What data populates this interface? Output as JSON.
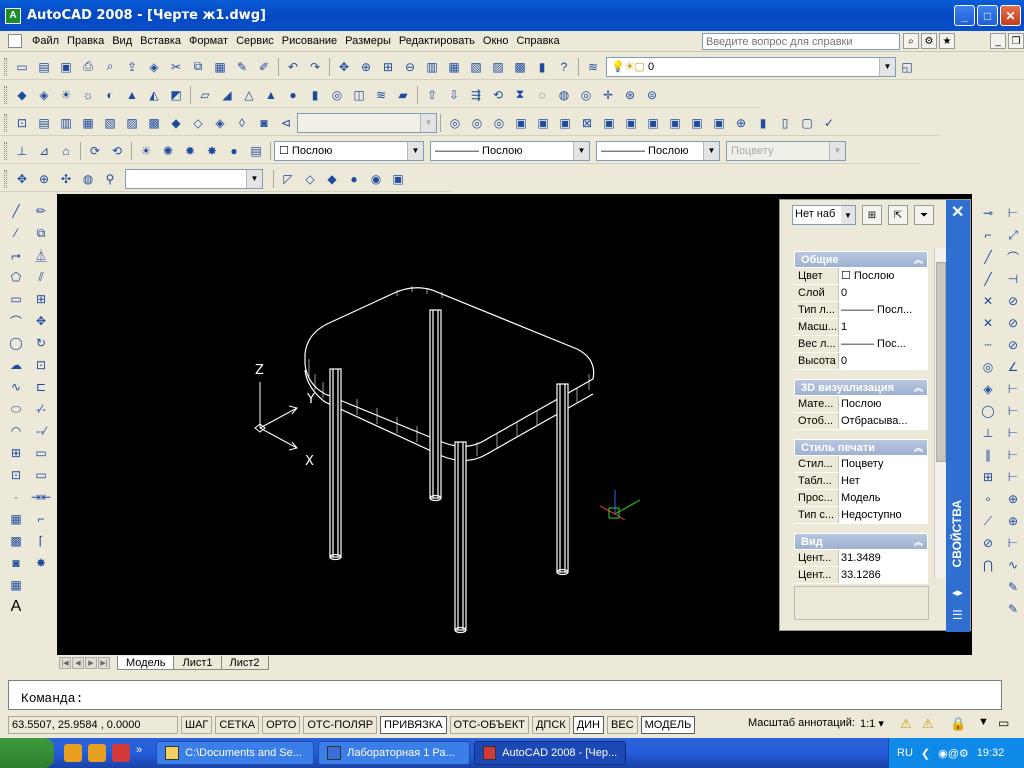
{
  "window": {
    "title": "AutoCAD 2008 - [Черте ж1.dwg]",
    "minimize": "_",
    "maximize": "□",
    "close": "✕"
  },
  "menu": {
    "items": [
      "Файл",
      "Правка",
      "Вид",
      "Вставка",
      "Формат",
      "Сервис",
      "Рисование",
      "Размеры",
      "Редактировать",
      "Окно",
      "Справка"
    ]
  },
  "help": {
    "placeholder": "Введите вопрос для справки"
  },
  "layers_toolbar": {
    "layer_value": "0"
  },
  "properties_toolbar": {
    "color": "☐ Послою",
    "linetype": "———— Послою",
    "lineweight": "———— Послою",
    "plotstyle": "Поцвету"
  },
  "ucs": {
    "z": "Z",
    "y": "Y",
    "x": "X"
  },
  "props_panel": {
    "selection": "Нет наб",
    "vertical_title": "СВОЙСТВА",
    "sections": [
      {
        "title": "Общие",
        "rows": [
          {
            "k": "Цвет",
            "v": "☐ Послою"
          },
          {
            "k": "Слой",
            "v": "0"
          },
          {
            "k": "Тип л...",
            "v": "——— Посл..."
          },
          {
            "k": "Масш...",
            "v": "1"
          },
          {
            "k": "Вес л...",
            "v": "——— Пос..."
          },
          {
            "k": "Высота",
            "v": "0"
          }
        ]
      },
      {
        "title": "3D визуализация",
        "rows": [
          {
            "k": "Мате...",
            "v": "Послою"
          },
          {
            "k": "Отоб...",
            "v": "Отбрасыва..."
          }
        ]
      },
      {
        "title": "Стиль печати",
        "rows": [
          {
            "k": "Стил...",
            "v": "Поцвету"
          },
          {
            "k": "Табл...",
            "v": "Нет"
          },
          {
            "k": "Прос...",
            "v": "Модель"
          },
          {
            "k": "Тип с...",
            "v": "Недоступно"
          }
        ]
      },
      {
        "title": "Вид",
        "rows": [
          {
            "k": "Цент...",
            "v": "31.3489"
          },
          {
            "k": "Цент...",
            "v": "33.1286"
          }
        ]
      }
    ]
  },
  "layout_tabs": [
    "Модель",
    "Лист1",
    "Лист2"
  ],
  "command": {
    "prompt": "Команда:"
  },
  "status": {
    "coords": "63.5507, 25.9584 , 0.0000",
    "buttons": [
      {
        "label": "ШАГ",
        "on": false
      },
      {
        "label": "СЕТКА",
        "on": false
      },
      {
        "label": "ОРТО",
        "on": false
      },
      {
        "label": "ОТС-ПОЛЯР",
        "on": false
      },
      {
        "label": "ПРИВЯЗКА",
        "on": true
      },
      {
        "label": "ОТС-ОБЪЕКТ",
        "on": false
      },
      {
        "label": "ДПСК",
        "on": false
      },
      {
        "label": "ДИН",
        "on": true
      },
      {
        "label": "ВЕС",
        "on": false
      },
      {
        "label": "МОДЕЛЬ",
        "on": true
      }
    ],
    "annotation": "Масштаб аннотаций:",
    "annotation_value": "1:1 ▾"
  },
  "taskbar": {
    "tasks": [
      {
        "label": "C:\\Documents and Se...",
        "active": false
      },
      {
        "label": "Лабораторная 1  Ра...",
        "active": false
      },
      {
        "label": "AutoCAD 2008 - [Чер...",
        "active": true
      }
    ],
    "lang": "RU",
    "clock": "19:32"
  }
}
